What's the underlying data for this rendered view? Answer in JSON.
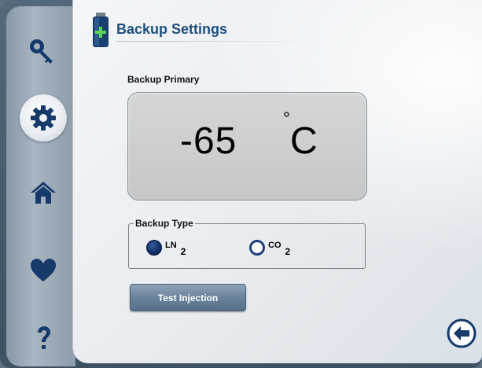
{
  "colors": {
    "accent": "#1e4f7e",
    "sidebar": "#9aaab7",
    "radio_selected": "#0f2a63",
    "button": "#6a829b"
  },
  "nav": {
    "items": [
      {
        "name": "key-icon",
        "active": false
      },
      {
        "name": "gear-icon",
        "active": true
      },
      {
        "name": "home-icon",
        "active": false
      },
      {
        "name": "heart-icon",
        "active": false
      },
      {
        "name": "help-icon",
        "active": false
      }
    ]
  },
  "header": {
    "icon": "battery-plus-icon",
    "title": "Backup Settings"
  },
  "backup": {
    "primary_label": "Backup Primary",
    "temperature": "-65",
    "degree_symbol": "°",
    "unit": "C"
  },
  "backup_type": {
    "legend": "Backup Type",
    "options": [
      {
        "label": "LN",
        "subscript": "2",
        "selected": true
      },
      {
        "label": "CO",
        "subscript": "2",
        "selected": false
      }
    ]
  },
  "actions": {
    "test_injection_label": "Test Injection",
    "back_icon": "back-arrow-icon"
  }
}
